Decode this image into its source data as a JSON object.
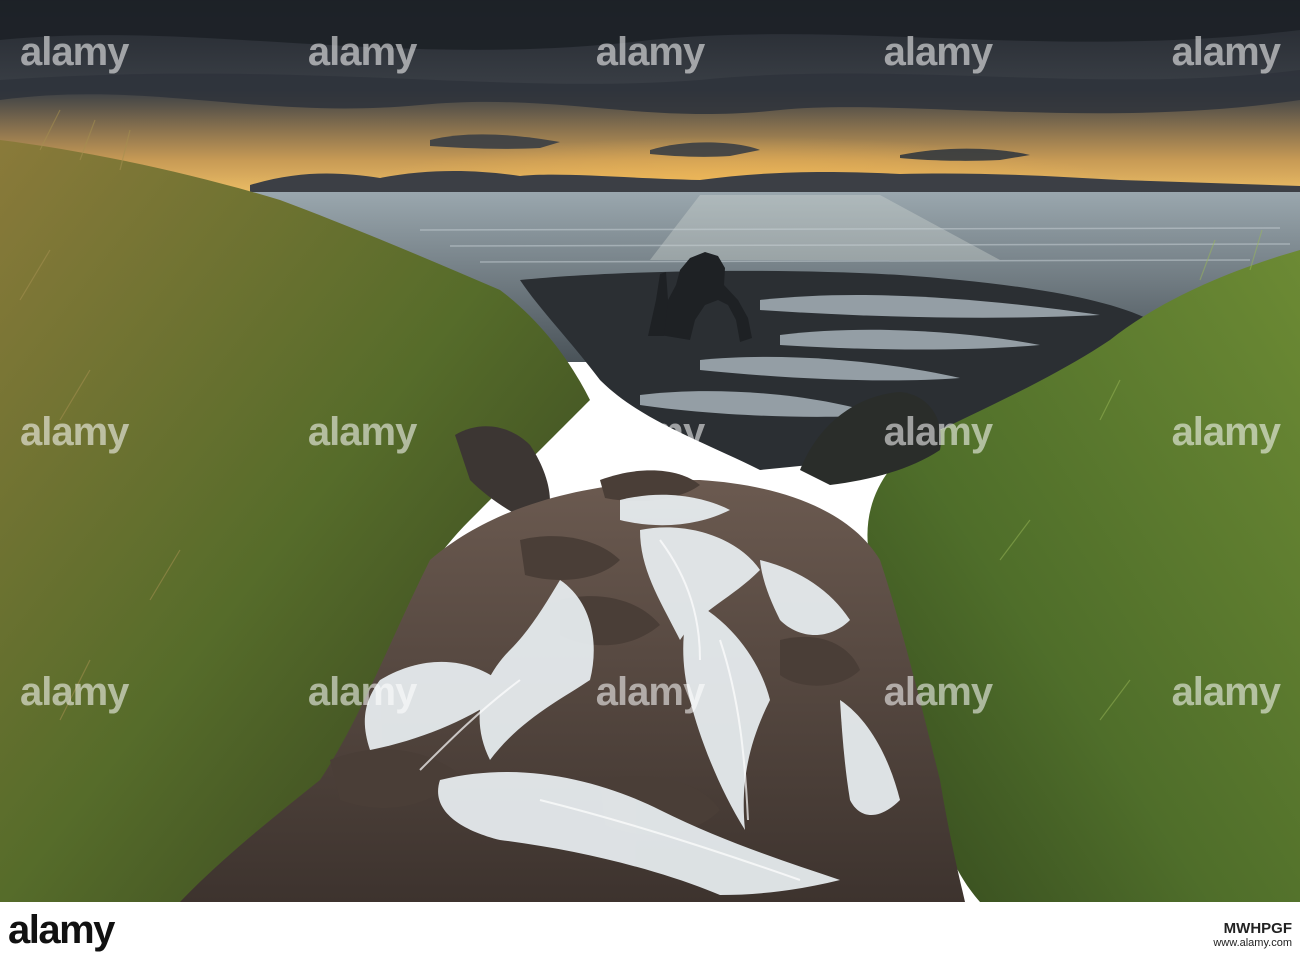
{
  "watermark": {
    "text": "alamy"
  },
  "footer": {
    "logo": "alamy",
    "ref_line": "www.alamy.com",
    "ref_code": "MWHPGF"
  },
  "colors": {
    "sky_dark": "#2a3038",
    "sunset": "#f2b54a",
    "sea": "#8d9aa3",
    "sand": "#2b2f33",
    "grass": "#5f7a2e",
    "water": "#e8eef2"
  }
}
